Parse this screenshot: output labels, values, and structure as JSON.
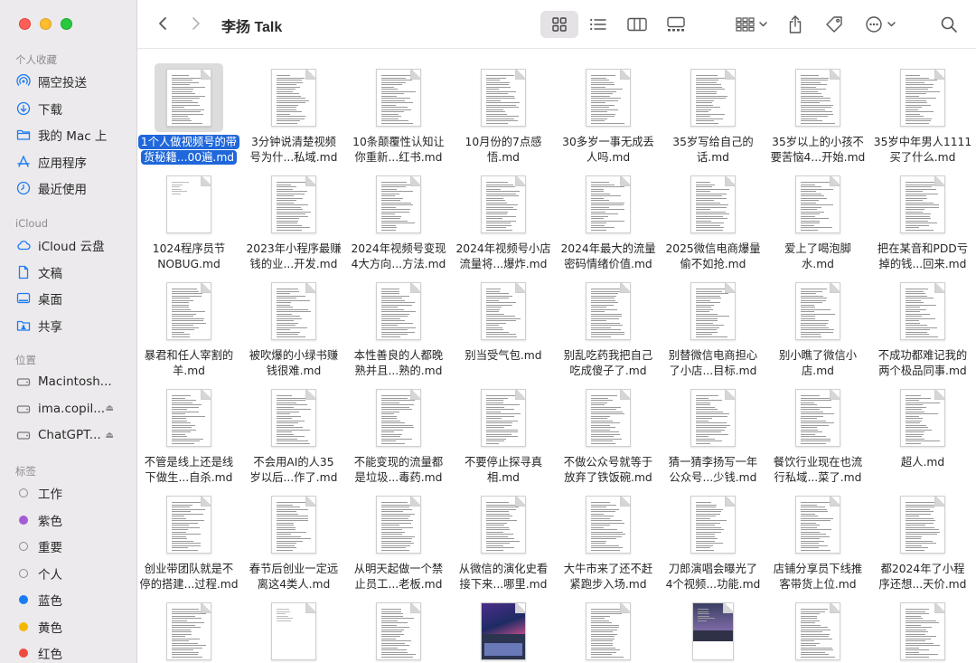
{
  "window": {
    "title": "李扬 Talk"
  },
  "sidebar": {
    "favorites_header": "个人收藏",
    "favorites": [
      {
        "label": "隔空投送",
        "icon": "airdrop-icon"
      },
      {
        "label": "下载",
        "icon": "download-icon"
      },
      {
        "label": "我的 Mac 上",
        "icon": "folder-icon"
      },
      {
        "label": "应用程序",
        "icon": "applications-icon"
      },
      {
        "label": "最近使用",
        "icon": "clock-icon"
      }
    ],
    "icloud_header": "iCloud",
    "icloud": [
      {
        "label": "iCloud 云盘",
        "icon": "cloud-icon"
      },
      {
        "label": "文稿",
        "icon": "document-icon"
      },
      {
        "label": "桌面",
        "icon": "desktop-icon"
      },
      {
        "label": "共享",
        "icon": "shared-folder-icon"
      }
    ],
    "locations_header": "位置",
    "locations": [
      {
        "label": "Macintosh...",
        "icon": "disk-icon"
      },
      {
        "label": "ima.copil...",
        "icon": "disk-icon"
      },
      {
        "label": "ChatGPT...",
        "icon": "disk-icon"
      }
    ],
    "eject_glyph": "⏏",
    "tags_header": "标签",
    "tags": [
      {
        "label": "工作",
        "color": "hollow"
      },
      {
        "label": "紫色",
        "color": "#a45bd6"
      },
      {
        "label": "重要",
        "color": "hollow"
      },
      {
        "label": "个人",
        "color": "hollow"
      },
      {
        "label": "蓝色",
        "color": "#1a7cf5"
      },
      {
        "label": "黄色",
        "color": "#f5b800"
      },
      {
        "label": "红色",
        "color": "#f04a3e"
      }
    ]
  },
  "files": [
    "1个人做视频号的带\n货秘籍...00遍.md",
    "3分钟说清楚视频\n号为什...私域.md",
    "10条颠覆性认知让\n你重新...红书.md",
    "10月份的7点感\n悟.md",
    "30多岁一事无成丢\n人吗.md",
    "35岁写给自己的\n话.md",
    "35岁以上的小孩不\n要苦恼4...开始.md",
    "35岁中年男人1111\n买了什么.md",
    "1024程序员节\nNOBUG.md",
    "2023年小程序最赚\n钱的业...开发.md",
    "2024年视频号变现\n4大方向...方法.md",
    "2024年视频号小店\n流量将...爆炸.md",
    "2024年最大的流量\n密码情绪价值.md",
    "2025微信电商爆量\n偷不如抢.md",
    "爱上了喝泡脚\n水.md",
    "把在某音和PDD亏\n掉的钱...回来.md",
    "暴君和任人宰割的\n羊.md",
    "被吹爆的小绿书赚\n钱很难.md",
    "本性善良的人都晚\n熟并且...熟的.md",
    "别当受气包.md",
    "别乱吃药我把自己\n吃成傻子了.md",
    "别替微信电商担心\n了小店...目标.md",
    "别小瞧了微信小\n店.md",
    "不成功都难记我的\n两个极品同事.md",
    "不管是线上还是线\n下做生...自杀.md",
    "不会用AI的人35\n岁以后...作了.md",
    "不能变现的流量都\n是垃圾...毒药.md",
    "不要停止探寻真\n相.md",
    "不做公众号就等于\n放弃了铁饭碗.md",
    "猜一猜李扬写一年\n公众号...少钱.md",
    "餐饮行业现在也流\n行私域...菜了.md",
    "超人.md",
    "创业带团队就是不\n停的搭建...过程.md",
    "春节后创业一定远\n离这4类人.md",
    "从明天起做一个禁\n止员工...老板.md",
    "从微信的演化史看\n接下来...哪里.md",
    "大牛市来了还不赶\n紧跑步入场.md",
    "刀郎演唱会曝光了\n4个视频...功能.md",
    "店铺分享员下线推\n客带货上位.md",
    "都2024年了小程\n序还想...天价.md",
    "",
    "",
    "",
    "",
    "",
    "",
    "",
    ""
  ]
}
